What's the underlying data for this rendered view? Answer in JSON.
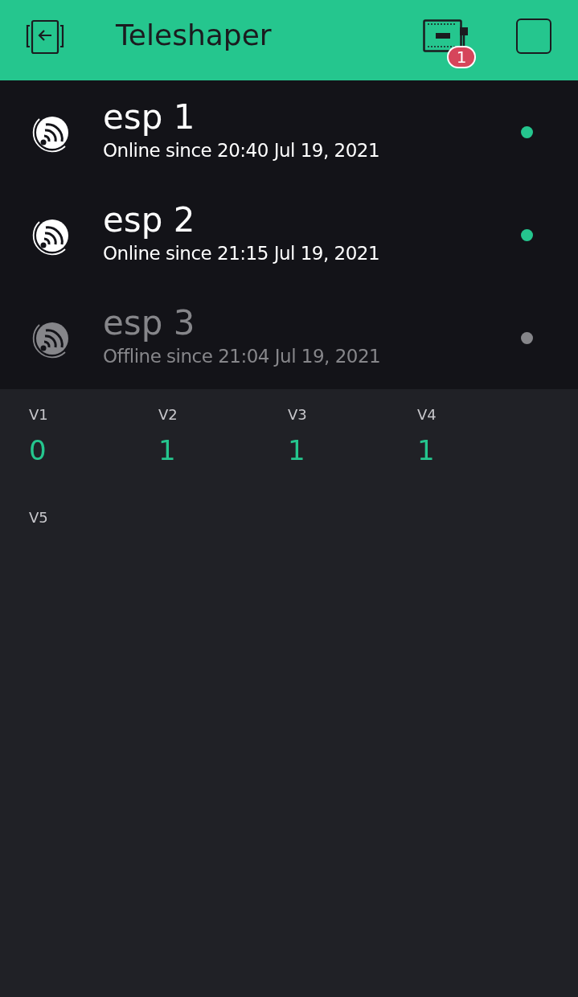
{
  "header": {
    "title": "Teleshaper",
    "badge": "1"
  },
  "devices": [
    {
      "name": "esp 1",
      "status": "Online since 20:40 Jul 19, 2021",
      "online": true
    },
    {
      "name": "esp 2",
      "status": "Online since 21:15 Jul 19, 2021",
      "online": true
    },
    {
      "name": "esp 3",
      "status": "Offline since 21:04 Jul 19, 2021",
      "online": false
    }
  ],
  "widgets": [
    {
      "label": "V1",
      "value": "0"
    },
    {
      "label": "V2",
      "value": "1"
    },
    {
      "label": "V3",
      "value": "1"
    },
    {
      "label": "V4",
      "value": "1"
    },
    {
      "label": "V5"
    }
  ]
}
